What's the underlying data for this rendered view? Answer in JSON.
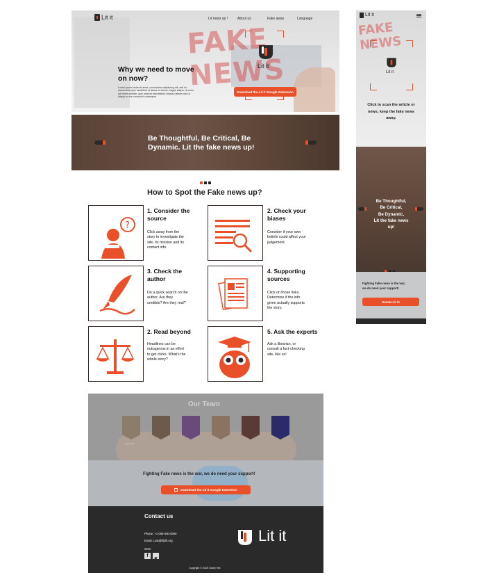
{
  "brand": {
    "name": "Lit it",
    "accent": "#e9502a",
    "dark": "#2a2a2a"
  },
  "nav": {
    "items": [
      "Lit news up !",
      "About us",
      "Fake away",
      "Language"
    ]
  },
  "hero": {
    "bg_headline": "FAKE NEWS",
    "heading_line1": "Why we need to move",
    "heading_line2": "on now?",
    "body_lines": [
      "Lorem ipsum dolor sit amet, consectetur adipiscing elit, sed do",
      "eiusmod tempor incididunt ut labore et dolore magna aliqua. Ut enim",
      "ad minim veniam, quis nostrud exercitation ullamco laboris nisi ut",
      "aliquip ex ea commodo consequat."
    ],
    "cta": "Download the Lit it Google Extension"
  },
  "banner": {
    "line1": "Be Thoughtful, Be Critical, Be",
    "line2": "Dynamic. Lit the fake news up!"
  },
  "how": {
    "title": "How to Spot the Fake news up?",
    "cards": [
      {
        "icon": "thinking-person-icon",
        "title1": "1. Consider the",
        "title2": "source",
        "text": [
          "Click away from the",
          "story to investigate the",
          "site, its mission and its",
          "contact info."
        ]
      },
      {
        "icon": "magnify-document-icon",
        "title1": "2. Check your",
        "title2": "biases",
        "text": [
          "Consider if your own",
          "beliefs could affect your",
          "judgement."
        ]
      },
      {
        "icon": "quill-icon",
        "title1": "3. Check the",
        "title2": "author",
        "text": [
          "Do a quick search on the",
          "author. Are they",
          "credible? Are they real?"
        ]
      },
      {
        "icon": "documents-icon",
        "title1": "4. Supporting",
        "title2": "sources",
        "text": [
          "Click on those links.",
          "Determine if the info",
          "given actually supports",
          "the story."
        ]
      },
      {
        "icon": "scale-icon",
        "title1": "2. Read beyond",
        "title2": "",
        "text": [
          "Headlines can be",
          "outrageous in an effort",
          "to get clicks. What's the",
          "whole story?"
        ]
      },
      {
        "icon": "owl-graduate-icon",
        "title1": "5. Ask the experts",
        "title2": "",
        "text": [
          "Ask a librarian, or",
          "consult a fact-checking",
          "site, like us!"
        ]
      }
    ]
  },
  "team": {
    "title": "Our Team",
    "first_member": "Jenna Yoo"
  },
  "support": {
    "text": "Fighting Fake news is the war, we do need your support!",
    "cta": "Download the Lit it Google Extension"
  },
  "footer": {
    "title": "Contact us",
    "phone": "Phone: +1 000-000-0000",
    "email": "Email: Lots@lit2lit.org",
    "sns": "SNS:",
    "copyright": "Copyright © 2019 Gloen Yee"
  },
  "mobile": {
    "caption": [
      "Click to scan the article or",
      "news, keep the fake news",
      "away."
    ],
    "banner": [
      "Be Thoughtful,",
      "Be Critical,",
      "Be Dynamic,",
      "Lit the fake news",
      "up!"
    ],
    "support": [
      "Fighting Fake news is the war,",
      "we do need your support!"
    ],
    "donate": "Donate Lit it!"
  }
}
